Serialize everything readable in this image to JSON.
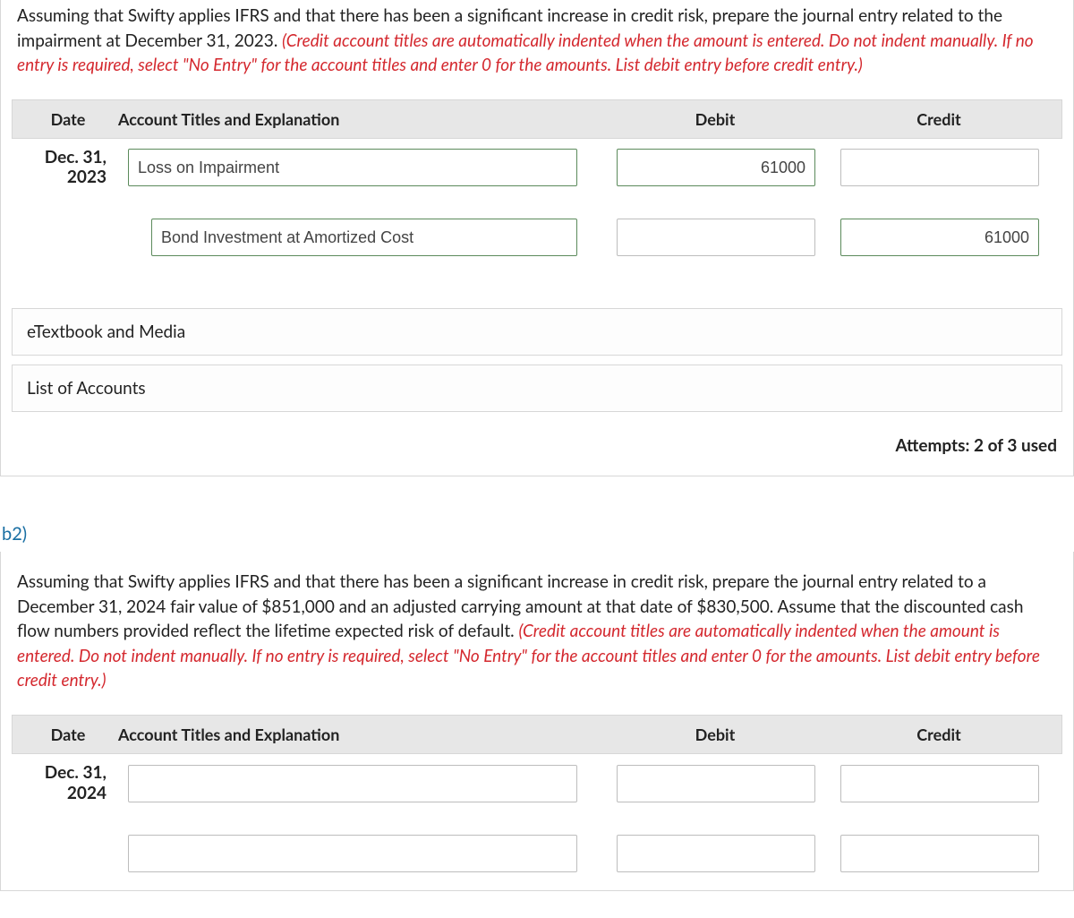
{
  "part_b1": {
    "instructions_black": "Assuming that Swifty applies IFRS and that there has been a significant increase in credit risk, prepare the journal entry related to the impairment at December 31, 2023. ",
    "instructions_red": "(Credit account titles are automatically indented when the amount is entered. Do not indent manually. If no entry is required, select \"No Entry\" for the account titles and enter 0 for the amounts. List debit entry before credit entry.)",
    "headers": {
      "date": "Date",
      "account": "Account Titles and Explanation",
      "debit": "Debit",
      "credit": "Credit"
    },
    "rows": [
      {
        "date": "Dec. 31, 2023",
        "account": "Loss on Impairment",
        "debit": "61000",
        "credit": ""
      },
      {
        "date": "",
        "account": "Bond Investment at Amortized Cost",
        "debit": "",
        "credit": "61000"
      }
    ],
    "links": {
      "etextbook": "eTextbook and Media",
      "list_accounts": "List of Accounts"
    },
    "attempts": "Attempts: 2 of 3 used"
  },
  "part_b2": {
    "label": "b2)",
    "instructions_black": "Assuming that Swifty applies IFRS and that there has been a significant increase in credit risk, prepare the journal entry related to a December 31, 2024 fair value of $851,000 and an adjusted carrying amount at that date of $830,500. Assume that the discounted cash flow numbers provided reflect the lifetime expected risk of default. ",
    "instructions_red": "(Credit account titles are automatically indented when the amount is entered. Do not indent manually. If no entry is required, select \"No Entry\" for the account titles and enter 0 for the amounts. List debit entry before credit entry.)",
    "headers": {
      "date": "Date",
      "account": "Account Titles and Explanation",
      "debit": "Debit",
      "credit": "Credit"
    },
    "rows": [
      {
        "date": "Dec. 31, 2024",
        "account": "",
        "debit": "",
        "credit": ""
      },
      {
        "date": "",
        "account": "",
        "debit": "",
        "credit": ""
      }
    ]
  }
}
